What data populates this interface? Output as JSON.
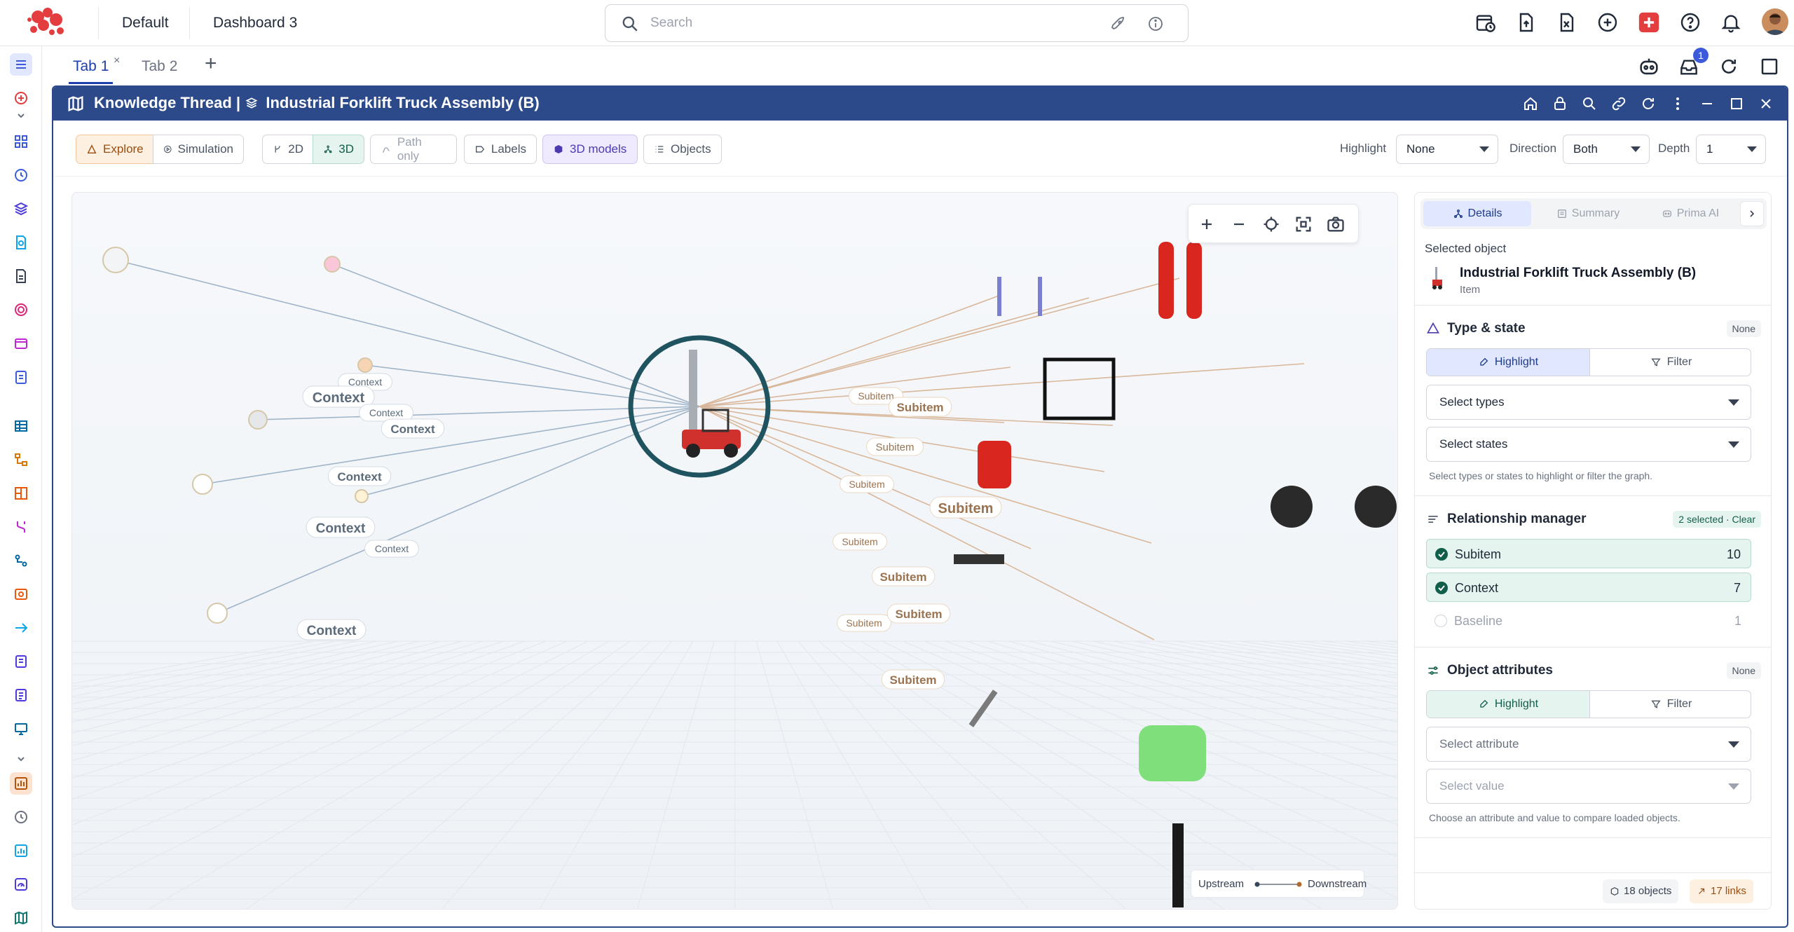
{
  "workspace": {
    "org": "Default",
    "dashboard": "Dashboard 3"
  },
  "search": {
    "placeholder": "Search"
  },
  "notifications": {
    "badge": "1"
  },
  "tabs": [
    {
      "label": "Tab 1",
      "close": "×"
    },
    {
      "label": "Tab 2"
    }
  ],
  "tab_add": "+",
  "window": {
    "app": "Knowledge Thread",
    "separator": "|",
    "title": "Industrial Forklift Truck Assembly (B)"
  },
  "toolbar": {
    "explore": "Explore",
    "simulation": "Simulation",
    "view2d": "2D",
    "view3d": "3D",
    "path_only": "Path only",
    "labels": "Labels",
    "models3d": "3D models",
    "objects": "Objects",
    "highlight_label": "Highlight",
    "highlight_value": "None",
    "direction_label": "Direction",
    "direction_value": "Both",
    "depth_label": "Depth",
    "depth_value": "1"
  },
  "graph": {
    "edge_labels_subitem": [
      "Subitem",
      "Subitem",
      "Subitem",
      "Subitem",
      "Subitem",
      "Subitem",
      "Subitem",
      "Subitem",
      "Subitem",
      "Subitem"
    ],
    "edge_labels_context": [
      "Context",
      "Context",
      "Context",
      "Context",
      "Context",
      "Context",
      "Context",
      "Context"
    ],
    "legend": {
      "upstream": "Upstream",
      "downstream": "Downstream"
    },
    "colors": {
      "subitem_edge": "#d9b79a",
      "context_edge": "#9fb4c8",
      "center_ring": "#1f5360"
    }
  },
  "panel": {
    "tabs": {
      "details": "Details",
      "summary": "Summary",
      "prima": "Prima AI"
    },
    "selected_label": "Selected object",
    "selected_name": "Industrial Forklift Truck Assembly (B)",
    "selected_type": "Item",
    "type_state": {
      "title": "Type & state",
      "badge": "None",
      "highlight": "Highlight",
      "filter": "Filter",
      "types": "Select types",
      "states": "Select states",
      "help": "Select types or states to highlight or filter the graph."
    },
    "relationship": {
      "title": "Relationship manager",
      "badge": "2 selected · Clear",
      "items": [
        {
          "name": "Subitem",
          "count": "10"
        },
        {
          "name": "Context",
          "count": "7"
        },
        {
          "name": "Baseline",
          "count": "1"
        }
      ]
    },
    "attributes": {
      "title": "Object attributes",
      "badge": "None",
      "highlight": "Highlight",
      "filter": "Filter",
      "attribute": "Select attribute",
      "value": "Select value",
      "help": "Choose an attribute and value to compare loaded objects."
    },
    "footer": {
      "objects": "18 objects",
      "links": "17 links"
    }
  }
}
